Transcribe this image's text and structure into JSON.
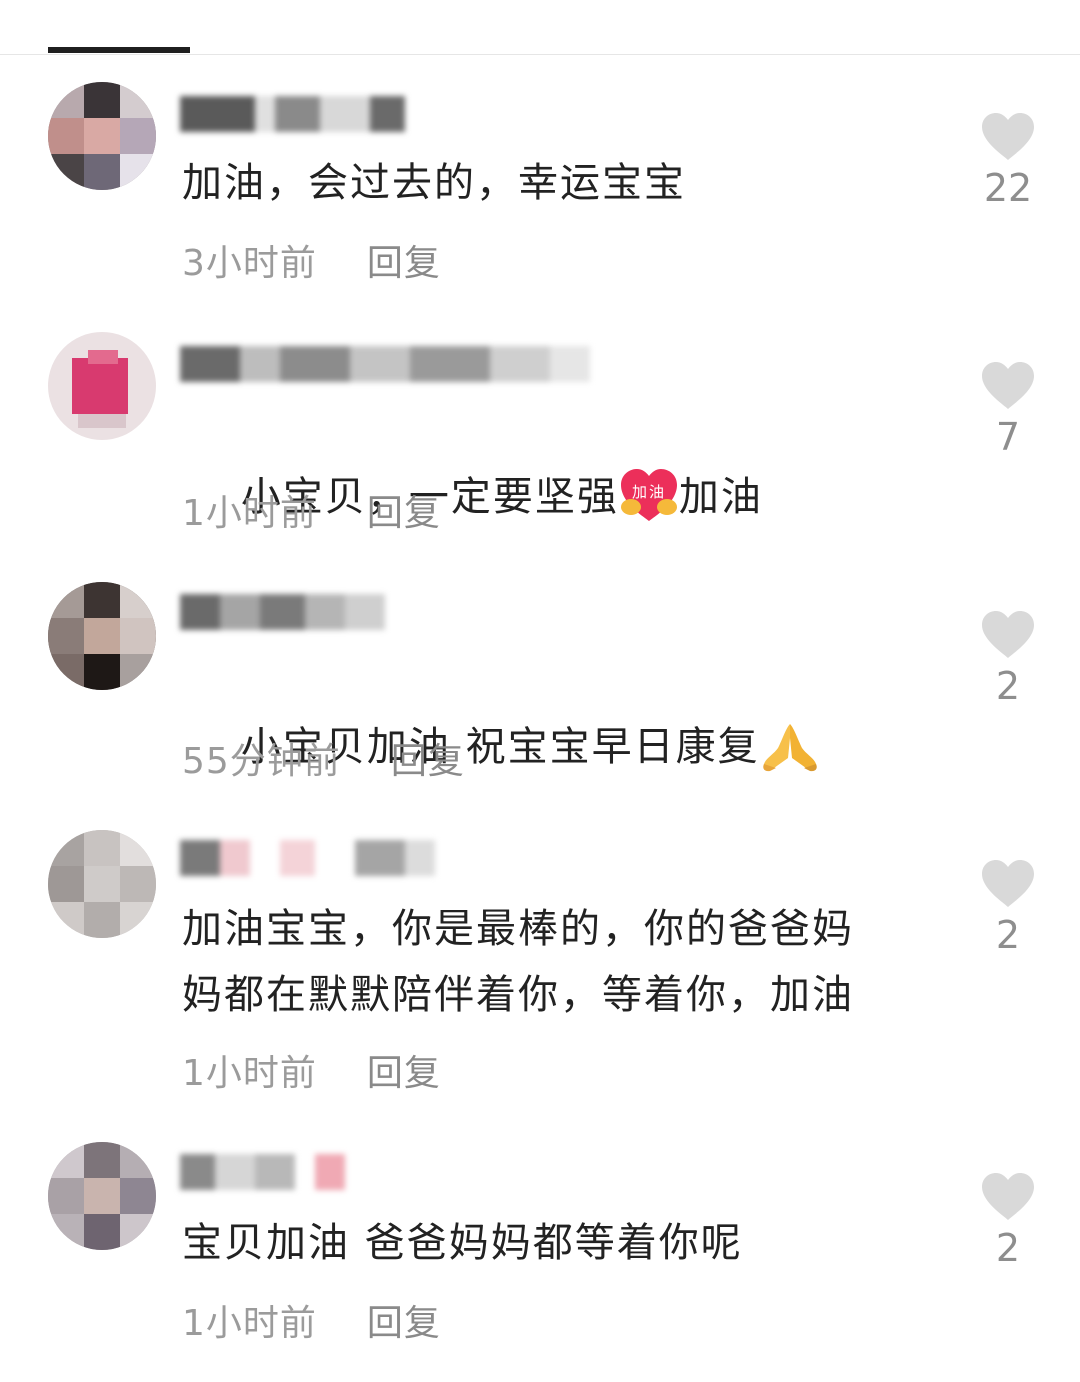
{
  "comments": [
    {
      "text": "加油，会过去的，幸运宝宝",
      "time": "3小时前",
      "reply": "回复",
      "likes": "22"
    },
    {
      "text_before": "小宝贝，一定要坚强",
      "emoji_label": "加油",
      "text_after": "加油",
      "time": "1小时前",
      "reply": "回复",
      "likes": "7"
    },
    {
      "text": "小宝贝加油 祝宝宝早日康复",
      "time": "55分钟前",
      "reply": "回复",
      "likes": "2"
    },
    {
      "text": "加油宝宝，你是最棒的，你的爸爸妈\n妈都在默默陪伴着你，等着你，加油",
      "time": "1小时前",
      "reply": "回复",
      "likes": "2"
    },
    {
      "text": "宝贝加油 爸爸妈妈都等着你呢",
      "time": "1小时前",
      "reply": "回复",
      "likes": "2"
    }
  ],
  "colors": {
    "text": "#222222",
    "meta": "#9b9b9b",
    "like_icon": "#d9d9d9",
    "like_count": "#8e8e8e"
  },
  "icons": {
    "like": "heart-icon",
    "pray": "praying-hands-icon"
  }
}
